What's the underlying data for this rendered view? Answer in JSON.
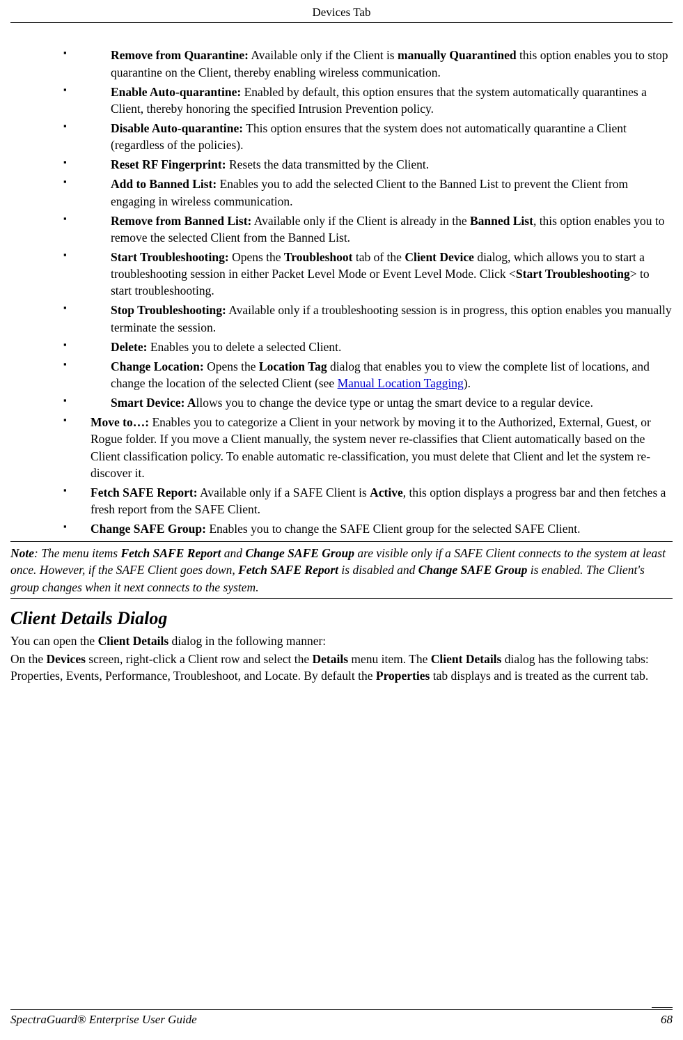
{
  "header": {
    "title": "Devices Tab"
  },
  "items": [
    {
      "label": "Remove from Quarantine:",
      "text_parts": [
        {
          "t": " Available only if the Client is "
        },
        {
          "t": "manually Quarantined",
          "b": true
        },
        {
          "t": " this option enables you to stop quarantine on the Client, thereby enabling wireless communication."
        }
      ]
    },
    {
      "label": "Enable Auto-quarantine:",
      "text_parts": [
        {
          "t": " Enabled by default, this option ensures that the system automatically quarantines a Client, thereby honoring the specified Intrusion Prevention policy."
        }
      ]
    },
    {
      "label": "Disable Auto-quarantine:",
      "text_parts": [
        {
          "t": " This option ensures that the system does not automatically quarantine a Client (regardless of the policies)."
        }
      ]
    },
    {
      "label": "Reset RF Fingerprint:",
      "text_parts": [
        {
          "t": " Resets the data transmitted by the Client."
        }
      ]
    },
    {
      "label": "Add to Banned List:",
      "text_parts": [
        {
          "t": " Enables you to add the selected Client to the Banned List to prevent the Client from engaging in wireless communication."
        }
      ]
    },
    {
      "label": "Remove from Banned List:",
      "text_parts": [
        {
          "t": " Available only if the Client is already in the "
        },
        {
          "t": "Banned List",
          "b": true
        },
        {
          "t": ", this option enables you to remove the selected Client from the Banned List."
        }
      ]
    },
    {
      "label": "Start Troubleshooting:",
      "text_parts": [
        {
          "t": " Opens the "
        },
        {
          "t": "Troubleshoot",
          "b": true
        },
        {
          "t": " tab of the "
        },
        {
          "t": "Client Device",
          "b": true
        },
        {
          "t": " dialog, which allows you to start a troubleshooting session in either Packet Level Mode or Event Level Mode. Click <"
        },
        {
          "t": "Start Troubleshooting",
          "b": true
        },
        {
          "t": "> to start troubleshooting."
        }
      ]
    },
    {
      "label": "Stop Troubleshooting:",
      "text_parts": [
        {
          "t": " Available only if a troubleshooting session is in progress, this option enables you manually terminate the session."
        }
      ]
    },
    {
      "label": "Delete:",
      "text_parts": [
        {
          "t": " Enables you to delete a selected Client."
        }
      ]
    },
    {
      "label": "Change Location:",
      "text_parts": [
        {
          "t": " Opens the "
        },
        {
          "t": "Location Tag",
          "b": true
        },
        {
          "t": " dialog that enables you to view the complete list of locations, and change the location of the selected Client (see "
        },
        {
          "t": "Manual Location Tagging",
          "link": true
        },
        {
          "t": ")."
        }
      ]
    },
    {
      "label": "Smart Device: A",
      "text_parts": [
        {
          "t": "llows you to change the device type or untag the smart device to a regular device."
        }
      ]
    },
    {
      "label": "Move to…:",
      "indent2": true,
      "text_parts": [
        {
          "t": " Enables you to categorize a Client in your network by moving it to the Authorized, External, Guest, or Rogue folder. If you move a Client manually, the system never re-classifies that Client automatically based on the Client classification policy. To enable automatic re-classification, you must delete that Client and let the system re-discover it."
        }
      ]
    },
    {
      "label": "Fetch SAFE Report:",
      "indent2": true,
      "text_parts": [
        {
          "t": " Available only if a SAFE Client is "
        },
        {
          "t": "Active",
          "b": true
        },
        {
          "t": ", this option displays a progress bar and then fetches a fresh report from the SAFE Client."
        }
      ]
    },
    {
      "label": "Change SAFE Group:",
      "indent2": true,
      "text_parts": [
        {
          "t": " Enables you to change the SAFE Client group for the selected SAFE Client."
        }
      ]
    }
  ],
  "note": {
    "prefix": "Note",
    "parts": [
      {
        "t": ": The menu items "
      },
      {
        "t": "Fetch SAFE Report",
        "b": true
      },
      {
        "t": " and "
      },
      {
        "t": "Change SAFE Group",
        "b": true
      },
      {
        "t": " are visible only if a SAFE Client connects to the system at least once. However, if the SAFE Client goes down, "
      },
      {
        "t": "Fetch SAFE Report",
        "b": true
      },
      {
        "t": " is disabled and "
      },
      {
        "t": "Change SAFE Group",
        "b": true
      },
      {
        "t": " is enabled. The Client's group changes when it next connects to the system."
      }
    ]
  },
  "section": {
    "heading": "Client Details Dialog",
    "para_parts": [
      {
        "t": "You can open the "
      },
      {
        "t": "Client Details",
        "b": true
      },
      {
        "t": " dialog in the following manner:"
      }
    ],
    "para2_parts": [
      {
        "t": "On the "
      },
      {
        "t": "Devices",
        "b": true
      },
      {
        "t": " screen, right-click a Client row and select the "
      },
      {
        "t": "Details",
        "b": true
      },
      {
        "t": " menu item. The "
      },
      {
        "t": "Client Details",
        "b": true
      },
      {
        "t": " dialog has the following tabs: Properties, Events, Performance, Troubleshoot, and Locate. By default the "
      },
      {
        "t": "Properties",
        "b": true
      },
      {
        "t": " tab displays and is treated as the current tab."
      }
    ]
  },
  "footer": {
    "title": "SpectraGuard®  Enterprise User Guide",
    "page": "68"
  }
}
